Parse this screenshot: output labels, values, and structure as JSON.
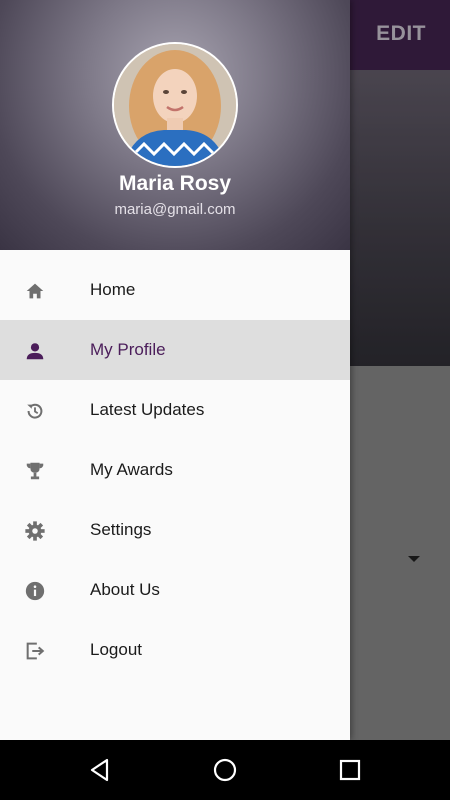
{
  "app_bar": {
    "edit_label": "EDIT"
  },
  "drawer": {
    "user": {
      "name": "Maria Rosy",
      "email": "maria@gmail.com"
    },
    "menu": [
      {
        "label": "Home",
        "icon": "home-icon",
        "active": false
      },
      {
        "label": "My Profile",
        "icon": "person-icon",
        "active": true
      },
      {
        "label": "Latest Updates",
        "icon": "history-icon",
        "active": false
      },
      {
        "label": "My Awards",
        "icon": "trophy-icon",
        "active": false
      },
      {
        "label": "Settings",
        "icon": "gear-icon",
        "active": false
      },
      {
        "label": "About Us",
        "icon": "info-icon",
        "active": false
      },
      {
        "label": "Logout",
        "icon": "logout-icon",
        "active": false
      }
    ]
  },
  "colors": {
    "accent": "#4b1d5a",
    "icon": "#6f6f6f",
    "active_bg": "#dedede"
  },
  "navbar": {
    "buttons": [
      "back-icon",
      "home-circle-icon",
      "recents-icon"
    ]
  }
}
